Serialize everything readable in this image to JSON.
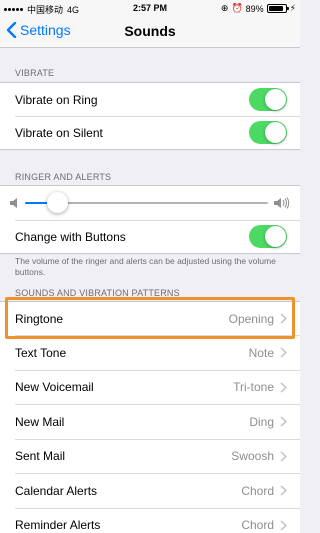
{
  "status_bar": {
    "carrier": "中国移动",
    "network": "4G",
    "time": "2:57 PM",
    "battery": "89%",
    "battery_level": 0.89
  },
  "nav": {
    "back_label": "Settings",
    "title": "Sounds"
  },
  "vibrate": {
    "header": "VIBRATE",
    "rows": [
      {
        "label": "Vibrate on Ring",
        "on": true
      },
      {
        "label": "Vibrate on Silent",
        "on": true
      }
    ]
  },
  "ringer": {
    "header": "RINGER AND ALERTS",
    "volume_level": 0.13,
    "change_label": "Change with Buttons",
    "change_on": true,
    "note": "The volume of the ringer and alerts can be adjusted using the volume buttons."
  },
  "patterns": {
    "header": "SOUNDS AND VIBRATION PATTERNS",
    "rows": [
      {
        "label": "Ringtone",
        "value": "Opening"
      },
      {
        "label": "Text Tone",
        "value": "Note"
      },
      {
        "label": "New Voicemail",
        "value": "Tri-tone"
      },
      {
        "label": "New Mail",
        "value": "Ding"
      },
      {
        "label": "Sent Mail",
        "value": "Swoosh"
      },
      {
        "label": "Calendar Alerts",
        "value": "Chord"
      },
      {
        "label": "Reminder Alerts",
        "value": "Chord"
      }
    ]
  },
  "colors": {
    "accent": "#007aff",
    "toggle_on": "#4cd964",
    "highlight": "#f0922b"
  }
}
